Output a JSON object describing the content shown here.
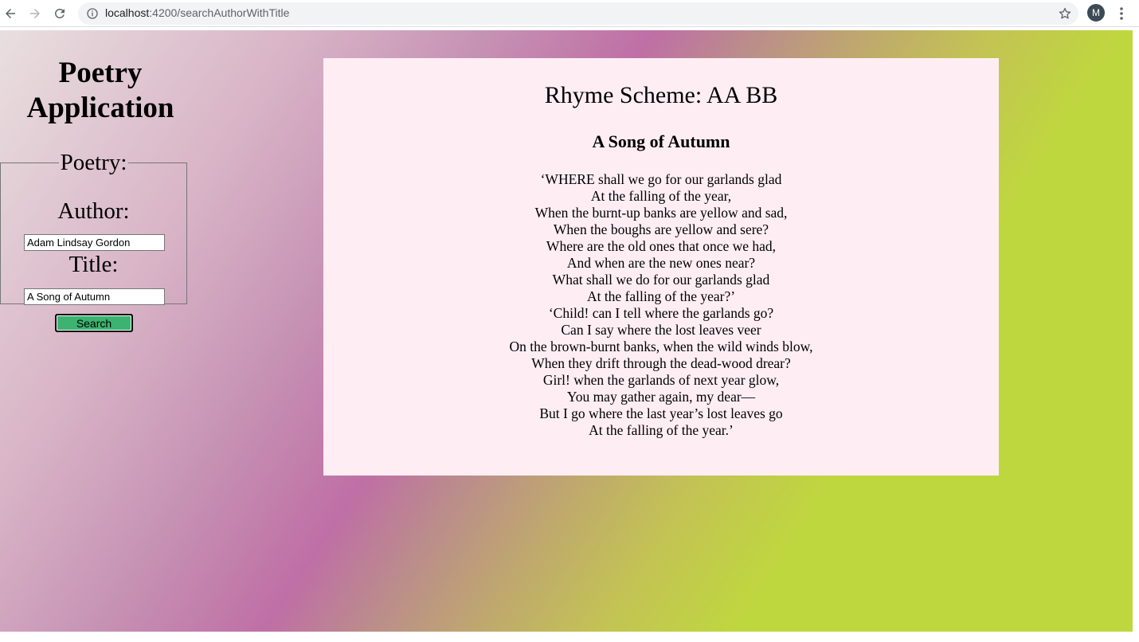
{
  "browser": {
    "url_host": "localhost",
    "url_path": ":4200/searchAuthorWithTitle",
    "profile_initial": "M"
  },
  "app": {
    "title": "Poetry Application"
  },
  "form": {
    "legend": "Poetry:",
    "author_label": "Author:",
    "author_value": "Adam Lindsay Gordon",
    "title_label": "Title:",
    "title_value": "A Song of Autumn",
    "search_label": "Search"
  },
  "result": {
    "rhyme_scheme": "Rhyme Scheme: AA BB",
    "poem_title": "A Song of Autumn",
    "lines": [
      "‘WHERE shall we go for our garlands glad",
      "At the falling of the year,",
      "When the burnt-up banks are yellow and sad,",
      "When the boughs are yellow and sere?",
      "Where are the old ones that once we had,",
      "And when are the new ones near?",
      "What shall we do for our garlands glad",
      "At the falling of the year?’",
      "‘Child! can I tell where the garlands go?",
      "Can I say where the lost leaves veer",
      "On the brown-burnt banks, when the wild winds blow,",
      "When they drift through the dead-wood drear?",
      "Girl! when the garlands of next year glow,",
      "You may gather again, my dear—",
      "But I go where the last year’s lost leaves go",
      "At the falling of the year.’"
    ]
  },
  "colors": {
    "card_background": "#feeef4",
    "search_button": "#3cb371",
    "gradient_pink": "#bf6fa5",
    "gradient_green": "#bfd73f"
  },
  "icons": [
    "back-arrow-icon",
    "forward-arrow-icon",
    "reload-icon",
    "info-icon",
    "star-icon",
    "kebab-menu-icon"
  ]
}
